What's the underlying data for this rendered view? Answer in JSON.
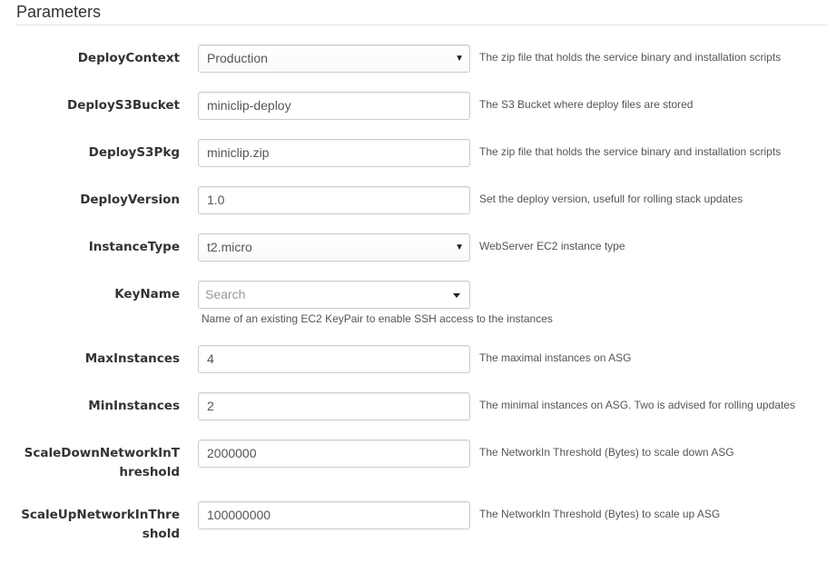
{
  "title": "Parameters",
  "params": [
    {
      "label": "DeployContext",
      "type": "select",
      "value": "Production",
      "help": "The zip file that holds the service binary and installation scripts"
    },
    {
      "label": "DeployS3Bucket",
      "type": "text",
      "value": "miniclip-deploy",
      "help": "The S3 Bucket where deploy files are stored"
    },
    {
      "label": "DeployS3Pkg",
      "type": "text",
      "value": "miniclip.zip",
      "help": "The zip file that holds the service binary and installation scripts"
    },
    {
      "label": "DeployVersion",
      "type": "text",
      "value": "1.0",
      "help": "Set the deploy version, usefull for rolling stack updates"
    },
    {
      "label": "InstanceType",
      "type": "select",
      "value": "t2.micro",
      "help": "WebServer EC2 instance type"
    },
    {
      "label": "KeyName",
      "type": "search-select",
      "placeholder": "Search",
      "help": "Name of an existing EC2 KeyPair to enable SSH access to the instances"
    },
    {
      "label": "MaxInstances",
      "type": "text",
      "value": "4",
      "help": "The maximal instances on ASG"
    },
    {
      "label": "MinInstances",
      "type": "text",
      "value": "2",
      "help": "The minimal instances on ASG. Two is advised for rolling updates"
    },
    {
      "label": "ScaleDownNetworkInThreshold",
      "type": "text",
      "value": "2000000",
      "help": "The NetworkIn Threshold (Bytes) to scale down ASG"
    },
    {
      "label": "ScaleUpNetworkInThreshold",
      "type": "text",
      "value": "100000000",
      "help": "The NetworkIn Threshold (Bytes) to scale up ASG"
    }
  ]
}
